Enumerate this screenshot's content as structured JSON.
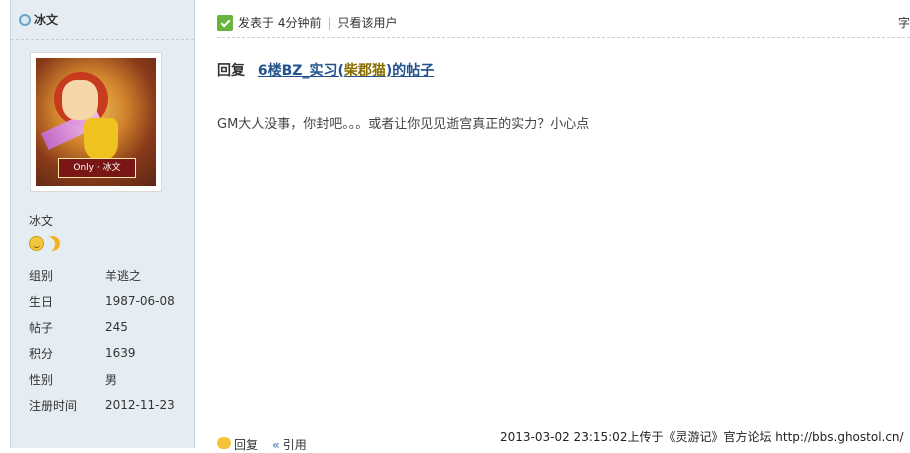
{
  "author": {
    "name": "冰文",
    "avatar_banner": "Only · 冰文",
    "display_name": "冰文",
    "medals": [
      "smile-medal",
      "moon-medal"
    ],
    "stats": [
      {
        "label": "组别",
        "value": "羊逃之"
      },
      {
        "label": "生日",
        "value": "1987-06-08"
      },
      {
        "label": "帖子",
        "value": "245"
      },
      {
        "label": "积分",
        "value": "1639"
      },
      {
        "label": "性别",
        "value": "男"
      },
      {
        "label": "注册时间",
        "value": "2012-11-23"
      }
    ]
  },
  "post": {
    "time_text": "发表于 4分钟前",
    "only_author": "只看该用户",
    "font_size_label": "字",
    "reply_prefix": "回复",
    "reply_link_a": "6楼BZ_实习(",
    "reply_link_b": "柴郡猫",
    "reply_link_c": ")的帖子",
    "body": "GM大人没事，你封吧。。。或者让你见见逝宫真正的实力？小心点",
    "actions": {
      "reply": "回复",
      "quote": "引用"
    }
  },
  "watermark": "2013-03-02 23:15:02上传于《灵游记》官方论坛 http://bbs.ghostol.cn/",
  "colors": {
    "sidebar_bg": "#e5edf2",
    "link": "#22538f",
    "highlight": "#8a6d00"
  }
}
